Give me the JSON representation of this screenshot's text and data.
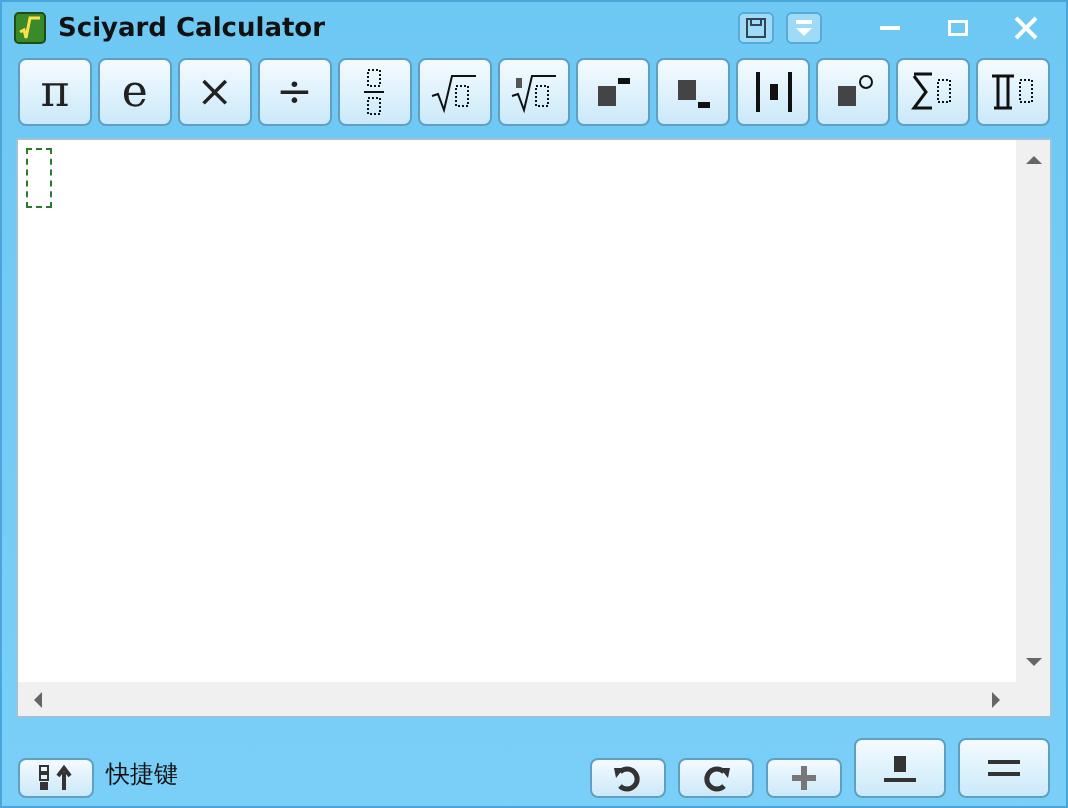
{
  "window": {
    "title": "Sciyard Calculator"
  },
  "toolbar": [
    {
      "kind": "symbol",
      "label": "π"
    },
    {
      "kind": "symbol",
      "label": "e"
    },
    {
      "kind": "symbol",
      "label": "×"
    },
    {
      "kind": "symbol",
      "label": "÷"
    },
    {
      "kind": "fraction"
    },
    {
      "kind": "sqrt"
    },
    {
      "kind": "nthroot"
    },
    {
      "kind": "superscript"
    },
    {
      "kind": "subscript"
    },
    {
      "kind": "abs"
    },
    {
      "kind": "degree"
    },
    {
      "kind": "sum"
    },
    {
      "kind": "product"
    }
  ],
  "status_bar": {
    "shortcut_label": "快捷键"
  }
}
